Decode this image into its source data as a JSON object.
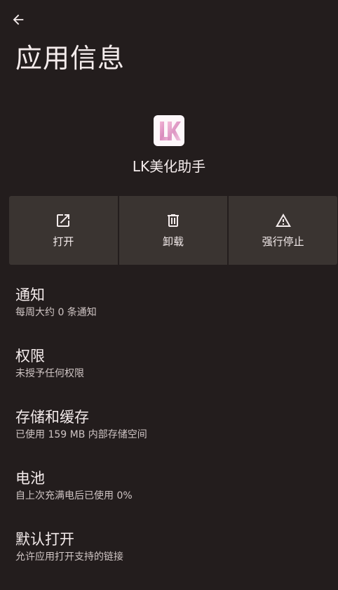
{
  "header": {
    "back_icon": "arrow-left-icon",
    "title": "应用信息"
  },
  "app": {
    "icon": "lk-app-icon",
    "icon_letters": "LK",
    "name": "LK美化助手"
  },
  "actions": [
    {
      "icon": "open-external-icon",
      "label": "打开"
    },
    {
      "icon": "trash-icon",
      "label": "卸载"
    },
    {
      "icon": "warning-triangle-icon",
      "label": "强行停止"
    }
  ],
  "settings": [
    {
      "title": "通知",
      "summary": "每周大约 0 条通知"
    },
    {
      "title": "权限",
      "summary": "未授予任何权限"
    },
    {
      "title": "存储和缓存",
      "summary": "已使用 159 MB 内部存储空间"
    },
    {
      "title": "电池",
      "summary": "自上次充满电后已使用 0%"
    },
    {
      "title": "默认打开",
      "summary": "允许应用打开支持的链接"
    }
  ],
  "colors": {
    "background": "#231d1d",
    "action_tile": "#3a3431",
    "text_primary": "#f4ecec",
    "text_secondary": "#cfc5c4",
    "icon_pink": "#e8a4c8"
  }
}
